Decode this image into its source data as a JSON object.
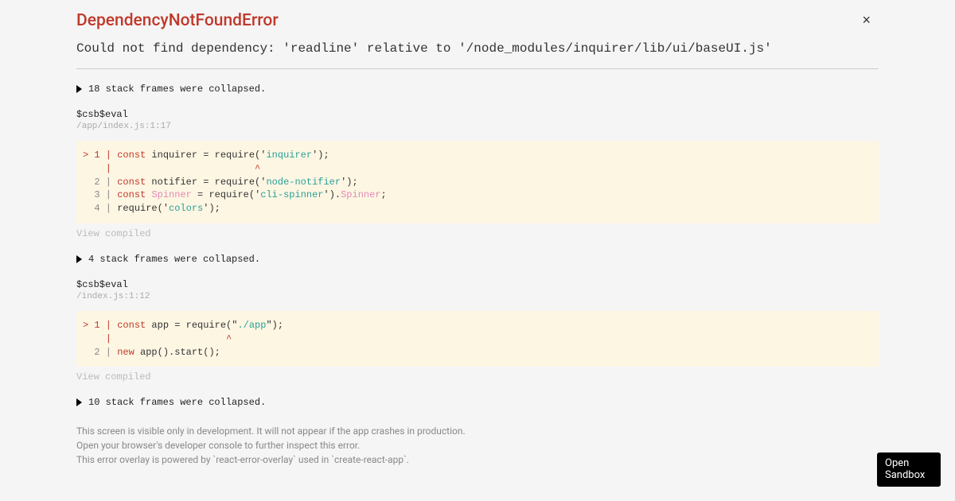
{
  "title": "DependencyNotFoundError",
  "message": "Could not find dependency: 'readline' relative to '/node_modules/inquirer/lib/ui/baseUI.js'",
  "close_label": "×",
  "collapsed": [
    "18 stack frames were collapsed.",
    "4 stack frames were collapsed.",
    "10 stack frames were collapsed."
  ],
  "frames": [
    {
      "fn": "$csb$eval",
      "loc": "/app/index.js:1:17",
      "view_compiled": "View compiled"
    },
    {
      "fn": "$csb$eval",
      "loc": "/index.js:1:12",
      "view_compiled": "View compiled"
    }
  ],
  "footer": {
    "line1": "This screen is visible only in development. It will not appear if the app crashes in production.",
    "line2": "Open your browser's developer console to further inspect this error.",
    "line3": "This error overlay is powered by `react-error-overlay` used in `create-react-app`."
  },
  "open_sandbox": "Open\nSandbox",
  "code1": {
    "l1_prefix": "> 1 | ",
    "l1_kw": "const",
    "l1_mid": " inquirer = require('",
    "l1_str": "inquirer",
    "l1_end": "');",
    "caret": "    |                         ^",
    "l2_prefix": "  2 | ",
    "l2_kw": "const",
    "l2_mid": " notifier = require('",
    "l2_str": "node-notifier",
    "l2_end": "');",
    "l3_prefix": "  3 | ",
    "l3_kw": "const",
    "l3_mid1": " ",
    "l3_prop1": "Spinner",
    "l3_mid2": " = require('",
    "l3_str": "cli-spinner",
    "l3_mid3": "').",
    "l3_prop2": "Spinner",
    "l3_end": ";",
    "l4_prefix": "  4 | ",
    "l4_mid": "require('",
    "l4_str": "colors",
    "l4_end": "');"
  },
  "code2": {
    "l1_prefix": "> 1 | ",
    "l1_kw": "const",
    "l1_mid": " app = require(\"",
    "l1_str": "./app",
    "l1_end": "\");",
    "caret": "    |                    ^",
    "l2_prefix": "  2 | ",
    "l2_kw": "new",
    "l2_end": " app().start();"
  }
}
